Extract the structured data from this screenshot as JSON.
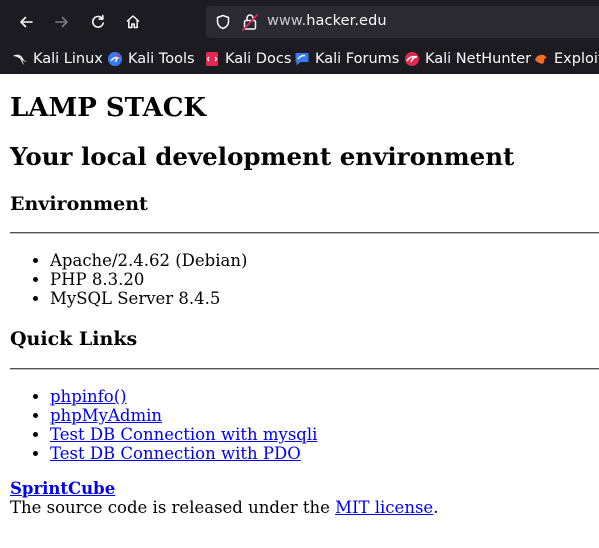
{
  "browser": {
    "url_prefix": "www.",
    "url_host": "hacker.edu",
    "colors": {
      "chrome_bg": "#1c1b22",
      "urlbar_bg": "#2b2a33",
      "link": "#0000ee"
    },
    "bookmarks": [
      {
        "label": "Kali Linux",
        "icon": "kali-dragon-icon"
      },
      {
        "label": "Kali Tools",
        "icon": "kali-tools-icon"
      },
      {
        "label": "Kali Docs",
        "icon": "kali-docs-icon"
      },
      {
        "label": "Kali Forums",
        "icon": "kali-forums-icon"
      },
      {
        "label": "Kali NetHunter",
        "icon": "kali-nethunter-icon"
      },
      {
        "label": "Exploit-DB",
        "icon": "exploit-db-icon"
      }
    ]
  },
  "page": {
    "title": "LAMP STACK",
    "subtitle": "Your local development environment",
    "environment": {
      "heading": "Environment",
      "items": [
        "Apache/2.4.62 (Debian)",
        "PHP 8.3.20",
        "MySQL Server 8.4.5"
      ]
    },
    "quick_links": {
      "heading": "Quick Links",
      "items": [
        "phpinfo()",
        "phpMyAdmin",
        "Test DB Connection with mysqli",
        "Test DB Connection with PDO"
      ]
    },
    "footer": {
      "title": "SprintCube",
      "text_before": "The source code is released under the ",
      "link": "MIT license",
      "text_after": "."
    }
  }
}
